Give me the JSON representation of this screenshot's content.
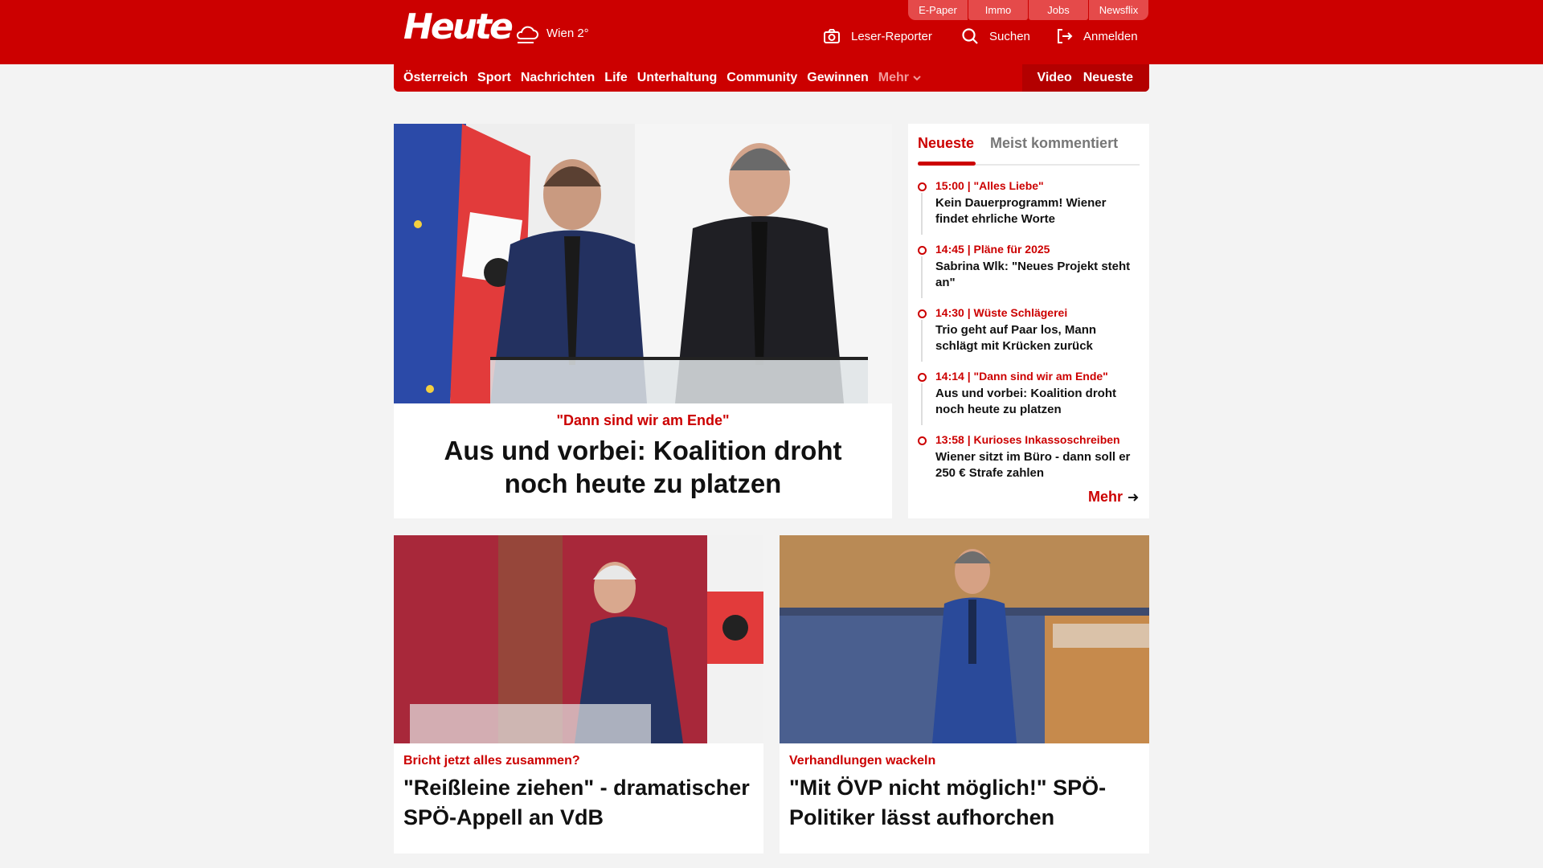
{
  "toplinks": [
    "E-Paper",
    "Immo",
    "Jobs",
    "Newsflix"
  ],
  "logo": "Heute",
  "weather": {
    "label": "Wien 2°"
  },
  "header_actions": {
    "reporter": "Leser-Reporter",
    "search": "Suchen",
    "login": "Anmelden"
  },
  "nav": {
    "items": [
      "Österreich",
      "Sport",
      "Nachrichten",
      "Life",
      "Unterhaltung",
      "Community",
      "Gewinnen"
    ],
    "more": "Mehr",
    "video": "Video",
    "latest": "Neueste"
  },
  "hero": {
    "kicker": "\"Dann sind wir am Ende\"",
    "title": "Aus und vorbei: Koalition droht noch heute zu platzen"
  },
  "sidebar": {
    "tabs": [
      "Neueste",
      "Meist kommentiert"
    ],
    "items": [
      {
        "meta": "15:00 | \"Alles Liebe\"",
        "title": "Kein Dauerprogramm! Wiener findet ehrliche Worte"
      },
      {
        "meta": "14:45 | Pläne für 2025",
        "title": "Sabrina Wlk: \"Neues Projekt steht an\""
      },
      {
        "meta": "14:30 | Wüste Schlägerei",
        "title": "Trio geht auf Paar los, Mann schlägt mit Krücken zurück"
      },
      {
        "meta": "14:14 | \"Dann sind wir am Ende\"",
        "title": "Aus und vorbei: Koalition droht noch heute zu platzen"
      },
      {
        "meta": "13:58 | Kurioses Inkassoschreiben",
        "title": "Wiener sitzt im Büro - dann soll er 250 € Strafe zahlen"
      }
    ],
    "more": "Mehr"
  },
  "cards": [
    {
      "kicker": "Bricht jetzt alles zusammen?",
      "title": "\"Reißleine ziehen\" - dramatischer SPÖ-Appell an VdB"
    },
    {
      "kicker": "Verhandlungen wackeln",
      "title": "\"Mit ÖVP nicht möglich!\" SPÖ-Politiker lässt aufhorchen"
    }
  ]
}
